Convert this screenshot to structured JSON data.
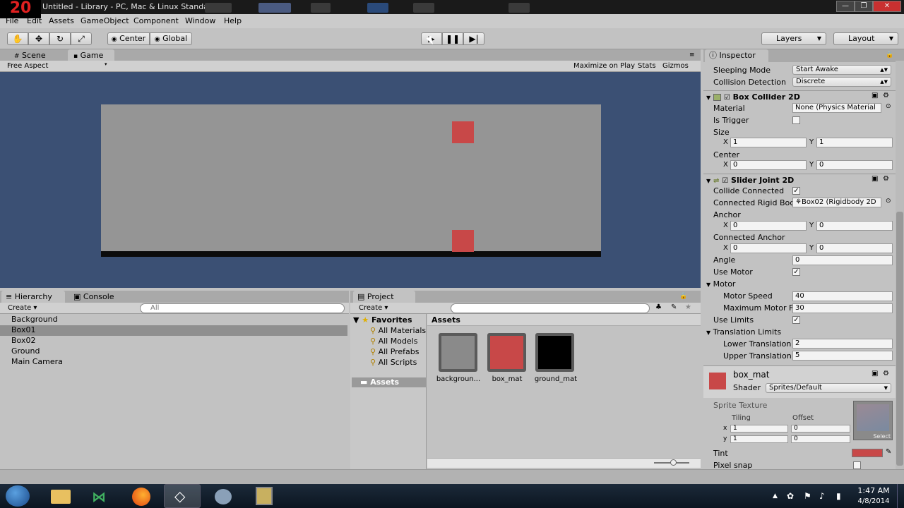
{
  "window": {
    "logo_text": "20",
    "title": "Untitled - Library - PC, Mac & Linux Standalone*"
  },
  "menu": [
    "File",
    "Edit",
    "Assets",
    "GameObject",
    "Component",
    "Window",
    "Help"
  ],
  "toolbar": {
    "center_label": "Center",
    "global_label": "Global",
    "layers_label": "Layers",
    "layout_label": "Layout"
  },
  "scene_tabs": {
    "scene": "Scene",
    "game": "Game"
  },
  "game_bar": {
    "aspect": "Free Aspect",
    "maximize": "Maximize on Play",
    "stats": "Stats",
    "gizmos": "Gizmos"
  },
  "hierarchy": {
    "tab": "Hierarchy",
    "console_tab": "Console",
    "create": "Create",
    "search_placeholder": "All",
    "items": [
      "Background",
      "Box01",
      "Box02",
      "Ground",
      "Main Camera"
    ],
    "selected_index": 1
  },
  "project": {
    "tab": "Project",
    "create": "Create",
    "favorites_label": "Favorites",
    "favorites": [
      "All Materials",
      "All Models",
      "All Prefabs",
      "All Scripts"
    ],
    "assets_folder": "Assets",
    "assets_header": "Assets",
    "assets": [
      {
        "name": "backgroun...",
        "color": "#8a8a8a"
      },
      {
        "name": "box_mat",
        "color": "#c84848"
      },
      {
        "name": "ground_mat",
        "color": "#000000"
      }
    ]
  },
  "inspector": {
    "tab": "Inspector",
    "sleeping_mode": {
      "label": "Sleeping Mode",
      "value": "Start Awake"
    },
    "collision_detection": {
      "label": "Collision Detection",
      "value": "Discrete"
    },
    "box_collider": {
      "title": "Box Collider 2D",
      "material_label": "Material",
      "material_value": "None (Physics Material",
      "is_trigger_label": "Is Trigger",
      "size_label": "Size",
      "size_x": "1",
      "size_y": "1",
      "center_label": "Center",
      "center_x": "0",
      "center_y": "0"
    },
    "slider_joint": {
      "title": "Slider Joint 2D",
      "collide_connected_label": "Collide Connected",
      "connected_rb_label": "Connected Rigid Boc",
      "connected_rb_value": "Box02 (Rigidbody 2D",
      "anchor_label": "Anchor",
      "anchor_x": "0",
      "anchor_y": "0",
      "connected_anchor_label": "Connected Anchor",
      "connected_anchor_x": "0",
      "connected_anchor_y": "0",
      "angle_label": "Angle",
      "angle_value": "0",
      "use_motor_label": "Use Motor",
      "motor_label": "Motor",
      "motor_speed_label": "Motor Speed",
      "motor_speed_value": "40",
      "max_motor_label": "Maximum Motor F",
      "max_motor_value": "30",
      "use_limits_label": "Use Limits",
      "translation_limits_label": "Translation Limits",
      "lower_label": "Lower Translation",
      "lower_value": "2",
      "upper_label": "Upper Translation",
      "upper_value": "5"
    },
    "material": {
      "name": "box_mat",
      "shader_label": "Shader",
      "shader_value": "Sprites/Default",
      "texture_label": "Sprite Texture",
      "tiling_label": "Tiling",
      "offset_label": "Offset",
      "tiling_x": "1",
      "tiling_y": "1",
      "offset_x": "0",
      "offset_y": "0",
      "select_label": "Select",
      "tint_label": "Tint",
      "pixel_snap_label": "Pixel snap",
      "color": "#c84848"
    },
    "x_label": "X",
    "y_label": "Y",
    "lx_label": "x",
    "ly_label": "y"
  },
  "clock": {
    "time": "1:47 AM",
    "date": "4/8/2014"
  },
  "colors": {
    "game_bg": "#3b5074",
    "play_area": "#959595",
    "box": "#c84848",
    "selection": "#8f8f8f"
  }
}
